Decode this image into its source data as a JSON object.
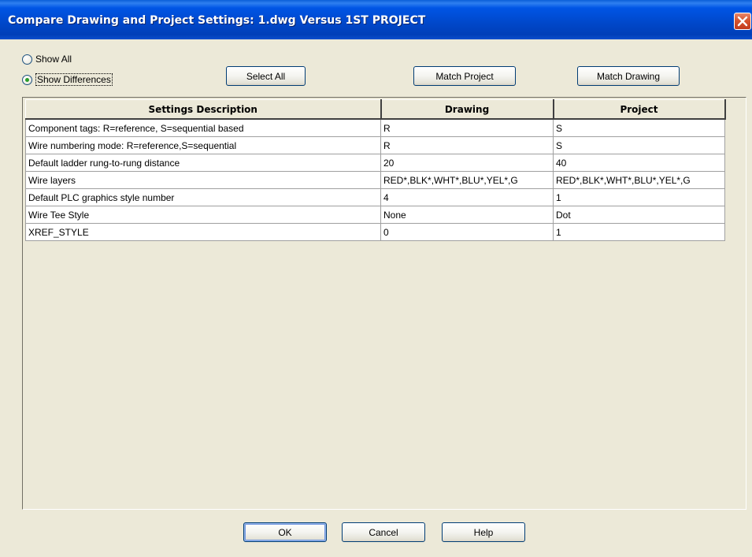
{
  "window": {
    "title": "Compare Drawing and Project Settings: 1.dwg Versus 1ST PROJECT"
  },
  "filter": {
    "show_all_label": "Show All",
    "show_differences_label": "Show Differences",
    "selected": "Show Differences"
  },
  "toolbar": {
    "select_all_label": "Select All",
    "match_project_label": "Match Project",
    "match_drawing_label": "Match Drawing"
  },
  "table": {
    "columns": [
      "Settings Description",
      "Drawing",
      "Project"
    ],
    "rows": [
      [
        "Component tags: R=reference, S=sequential based",
        "R",
        "S"
      ],
      [
        "Wire numbering mode: R=reference,S=sequential",
        "R",
        "S"
      ],
      [
        "Default ladder rung-to-rung distance",
        "20",
        "40"
      ],
      [
        "Wire layers",
        "RED*,BLK*,WHT*,BLU*,YEL*,G",
        "RED*,BLK*,WHT*,BLU*,YEL*,G"
      ],
      [
        "Default PLC graphics style number",
        "4",
        "1"
      ],
      [
        "Wire Tee Style",
        "None",
        "Dot"
      ],
      [
        "XREF_STYLE",
        "0",
        "1"
      ]
    ]
  },
  "footer": {
    "ok_label": "OK",
    "cancel_label": "Cancel",
    "help_label": "Help"
  },
  "icons": {
    "close": "close-icon"
  }
}
